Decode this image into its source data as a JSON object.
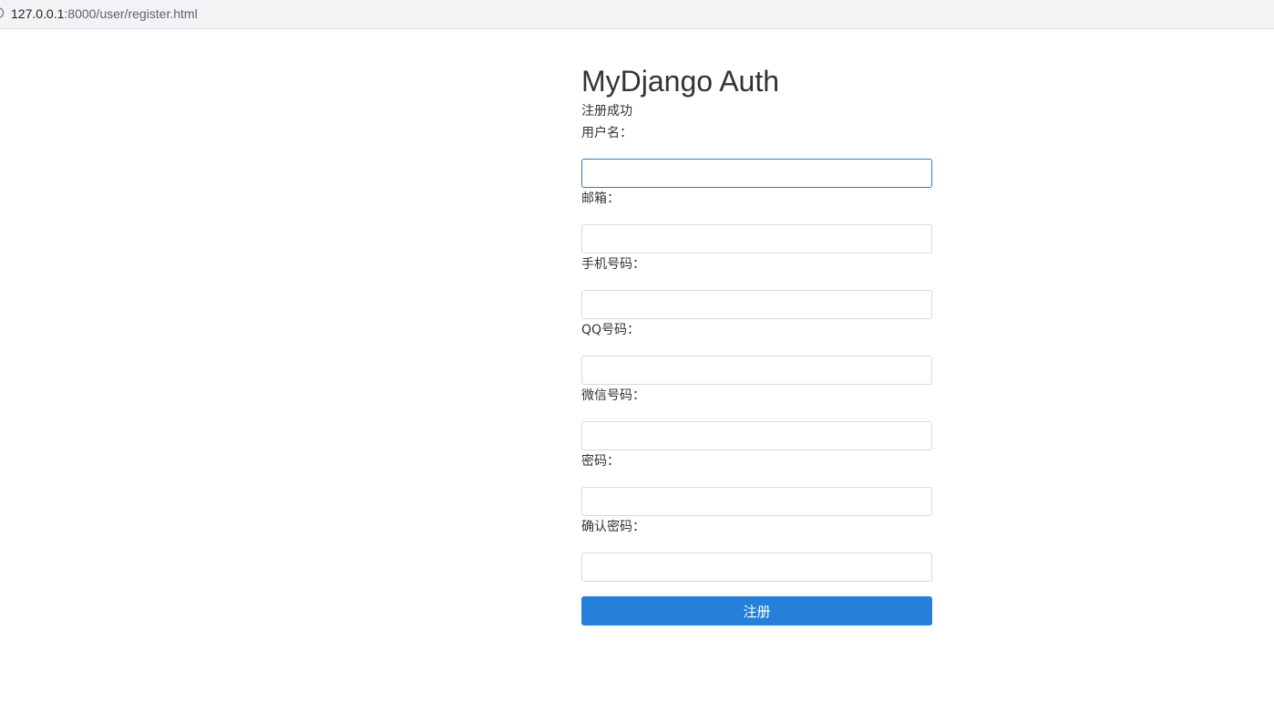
{
  "browser": {
    "url_host": "127.0.0.1",
    "url_path": ":8000/user/register.html"
  },
  "page": {
    "title": "MyDjango Auth",
    "message": "注册成功"
  },
  "form": {
    "username_label": "用户名：",
    "email_label": "邮箱：",
    "mobile_label": "手机号码：",
    "qq_label": "QQ号码：",
    "wechat_label": "微信号码：",
    "password_label": "密码：",
    "password_confirm_label": "确认密码：",
    "submit_label": "注册"
  }
}
